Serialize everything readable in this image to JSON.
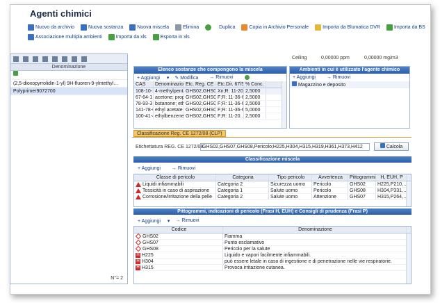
{
  "title": "Agenti chimici",
  "toolbar1": [
    "Nuovo da archivio",
    "Nuova sostanza",
    "Nuova miscela",
    "Elimina",
    "Duplica",
    "Copia in Archivio Personale",
    "Importa da Blumatica DVR",
    "Importa da BS"
  ],
  "toolbar2": [
    "Associazione multipla ambienti",
    "Importa da xls",
    "Esporta in xls"
  ],
  "left": {
    "header": "Denominazione",
    "rows": [
      "(2,5-dioxopyrrolidin-1-yl) 9H-fluoren-9-ylmethyl…",
      "Polyprimer9072700"
    ],
    "footer": "N°= 2"
  },
  "ceiling": {
    "label": "Ceiling",
    "ppm": "0,00000 ppm",
    "mg": "0,00000 mg/m3"
  },
  "subst": {
    "title": "Elenco sostanze che compongono la miscela",
    "actions": [
      "Aggiungi",
      "Modifica",
      "Rimuovi"
    ],
    "cols": [
      "CAS",
      "Denominazione",
      "Etc. Reg. CE 1…",
      "Etc.Dir. 67/5…",
      "% Conc."
    ],
    "rows": [
      [
        "108-10-1",
        "4-methylpenta…",
        "GHS02,GHS07,P…",
        "Xn;R: 11-20…",
        "2,5000"
      ],
      [
        "67-64-1",
        "acetone; prop…",
        "GHS02,GHS07,P…",
        "F;R: 11-36-66…",
        "2,5000"
      ],
      [
        "78-93-3",
        "butanone; eth…",
        "GHS02,GHS07,P…",
        "F;R: 11-36-66…",
        "2,5000"
      ],
      [
        "141-78-6",
        "ethyl acetate",
        "GHS02,GHS07,P…",
        "F;R: 11-36-66…",
        "5,0000"
      ],
      [
        "100-41-4",
        "ethylbenzene",
        "GHS02,GHS07,P…",
        "F;R: 11-20…",
        "2,5000"
      ]
    ]
  },
  "amb": {
    "title": "Ambienti in cui è utilizzato l'agente chimico",
    "actions": [
      "Aggiungi",
      "Rimuovi"
    ],
    "rows": [
      "Magazzino e deposito"
    ]
  },
  "tab": "Classificazione Reg. CE 1272/08  (CLP)",
  "etich": {
    "label": "Etichettatura REG. CE 1272/08",
    "value": "GHS02,GHS07,GHS08,Pericolo;H225,H304,H315,H319,H361,H373,H412",
    "button": "Calcola"
  },
  "clas": {
    "title": "Classificazione miscela",
    "actions": [
      "Aggiungi",
      "Rimuovi"
    ],
    "cols": [
      "Classe di pericolo",
      "Categoria",
      "Tipo pericolo",
      "Avvertenza",
      "Pittogrammi",
      "H, EUH, P"
    ],
    "rows": [
      [
        "Liquidi infiammabili",
        "Categoria 2",
        "Sicurezza uomo",
        "Pericolo",
        "GHS02",
        "H225,P210,…"
      ],
      [
        "Tossicità in caso di aspirazione",
        "Categoria 1",
        "Salute uomo",
        "Pericolo",
        "GHS08",
        "H304,P331,…"
      ],
      [
        "Corrosione/irritazione della pelle",
        "Categoria 2",
        "Salute uomo",
        "Attenzione",
        "GHS07",
        "H315,P264,…"
      ]
    ]
  },
  "pitt": {
    "title": "Pittogrammi, indicazioni di pericolo (Frasi H, EUH) e Consigli di prudenza (Frasi P)",
    "actions": [
      "Aggiungi",
      "Rimuovi"
    ],
    "cols": [
      "Codice",
      "Denominazione"
    ],
    "rows": [
      [
        "GHS02",
        "Fiamma"
      ],
      [
        "GHS07",
        "Punto esclamativo"
      ],
      [
        "GHS08",
        "Pericolo per la salute"
      ],
      [
        "H225",
        "Liquido e vapori facilmente infiammabili."
      ],
      [
        "H304",
        "può essere letale in caso di ingestione e di penetrazione nelle vie respiratorie."
      ],
      [
        "H315",
        "Provoca irritazione cutanea."
      ]
    ]
  }
}
